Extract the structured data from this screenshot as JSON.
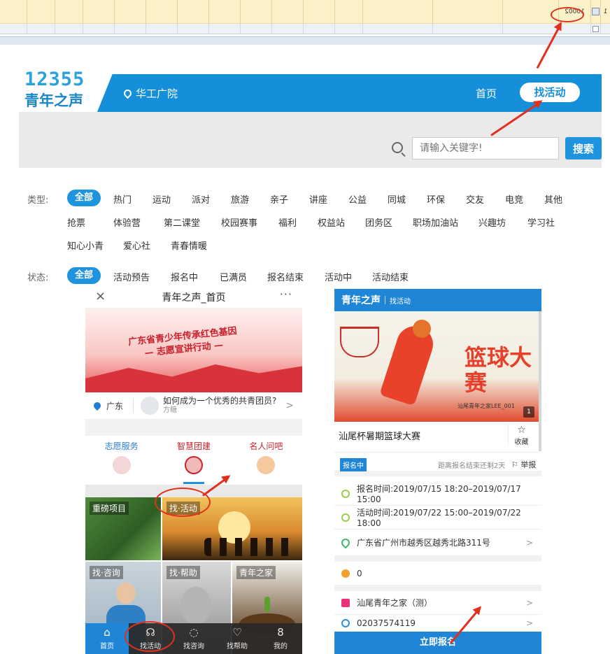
{
  "grid": {
    "row1": [
      "1",
      "",
      "10002",
      "",
      "",
      "",
      "",
      "",
      "",
      "",
      "",
      "",
      "",
      "",
      "",
      "",
      ""
    ],
    "row2": [
      "",
      "",
      "",
      "",
      "",
      "",
      "",
      "",
      "",
      "",
      "",
      "",
      "",
      "",
      "",
      "",
      ""
    ],
    "status_bar": "",
    "toolbar": [
      "",
      "",
      "",
      "",
      "",
      ""
    ]
  },
  "site": {
    "logo_number": "12355",
    "logo_text": "青年之声",
    "location": "华工广院",
    "nav_home": "首页",
    "nav_active": "找活动",
    "search_placeholder": "请输入关键字!",
    "search_button": "搜索",
    "type_label": "类型:",
    "status_label": "状态:",
    "types_row1": [
      "全部",
      "热门",
      "运动",
      "派对",
      "旅游",
      "亲子",
      "讲座",
      "公益",
      "同城",
      "环保",
      "交友",
      "电竞",
      "其他"
    ],
    "types_row2": [
      "抢票",
      "体验营",
      "第二课堂",
      "校园赛事",
      "福利",
      "权益站",
      "团务区",
      "职场加油站",
      "兴趣坊",
      "学习社"
    ],
    "types_row3": [
      "知心小青",
      "爱心社",
      "青春情暖"
    ],
    "statuses": [
      "全部",
      "活动预告",
      "报名中",
      "已满员",
      "报名结束",
      "活动中",
      "活动结束"
    ]
  },
  "phone1": {
    "close": "×",
    "title": "青年之声_首页",
    "more": "···",
    "banner_line1": "广东省青少年传承红色基因",
    "banner_line2": "— 志愿宣讲行动 —",
    "city": "广东",
    "question": "如何成为一个优秀的共青团员?",
    "question_sub": "方糖",
    "services": [
      "志愿服务",
      "智慧团建",
      "名人问吧"
    ],
    "tiles": [
      "重磅项目",
      "找·活动",
      "找·咨询",
      "找·帮助",
      "青年之家"
    ],
    "tabs": [
      {
        "icon": "⌂",
        "label": "首页"
      },
      {
        "icon": "☊",
        "label": "找活动"
      },
      {
        "icon": "◌",
        "label": "找咨询"
      },
      {
        "icon": "♡",
        "label": "找帮助"
      },
      {
        "icon": "8",
        "label": "我的"
      }
    ]
  },
  "phone2": {
    "brand": "青年之声",
    "sub": "找活动",
    "poster_big": "篮球大赛",
    "poster_tag": "汕尾青年之家LEE_001",
    "poster_page": "1",
    "event_name": "汕尾杯暑期篮球大赛",
    "fav": "收藏",
    "status_badge": "报名中",
    "remaining": "距离报名结束还剩2天",
    "report": "举报",
    "signup_time": "报名时间:2019/07/15 18:20–2019/07/17 15:00",
    "event_time": "活动时间:2019/07/22 15:00–2019/07/22 18:00",
    "address": "广东省广州市越秀区越秀北路311号",
    "count": "0",
    "organizer": "汕尾青年之家（测）",
    "phone": "02037574119",
    "signup_button": "立即报名"
  },
  "colors": {
    "brand_blue": "#1f85d6",
    "annotation_red": "#e2301f"
  }
}
